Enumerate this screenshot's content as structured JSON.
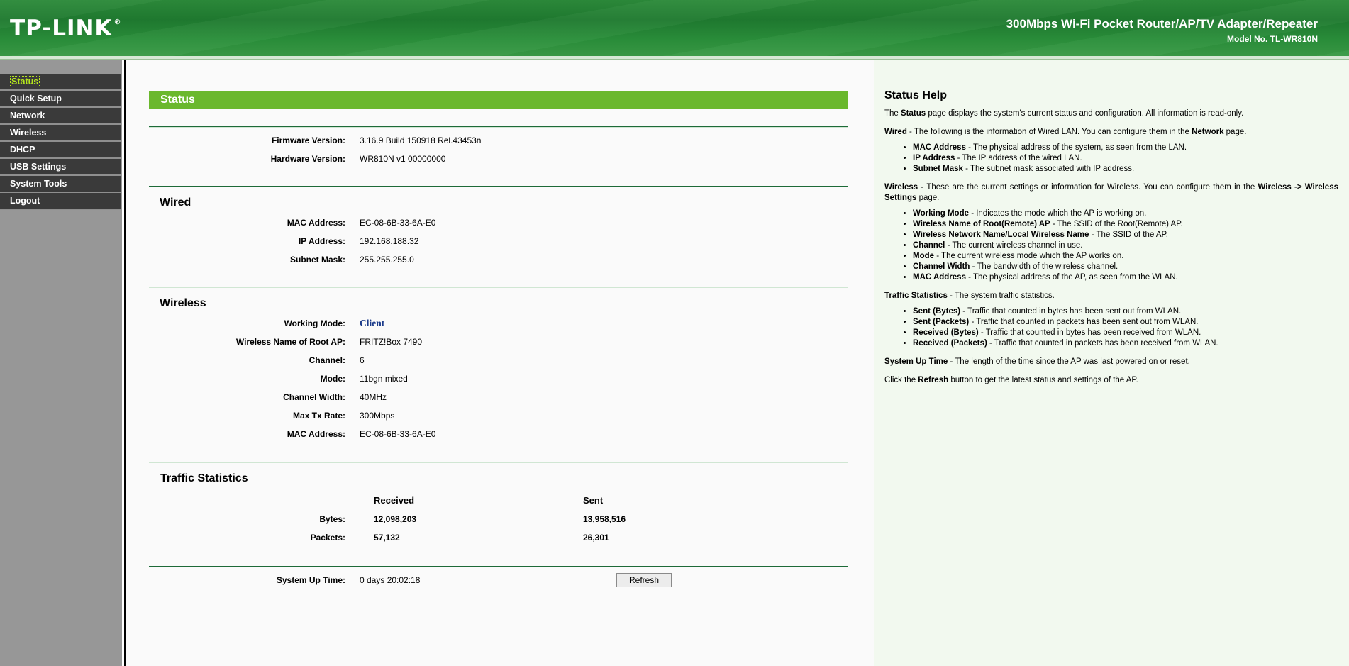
{
  "header": {
    "logo": "TP-LINK",
    "logo_reg": "®",
    "product": "300Mbps Wi-Fi Pocket Router/AP/TV Adapter/Repeater",
    "model": "Model No. TL-WR810N"
  },
  "sidebar": {
    "items": [
      {
        "label": "Status",
        "active": true
      },
      {
        "label": "Quick Setup"
      },
      {
        "label": "Network"
      },
      {
        "label": "Wireless"
      },
      {
        "label": "DHCP"
      },
      {
        "label": "USB Settings"
      },
      {
        "label": "System Tools"
      },
      {
        "label": "Logout"
      }
    ]
  },
  "main": {
    "title": "Status",
    "firmware": {
      "label": "Firmware Version:",
      "value": "3.16.9 Build 150918 Rel.43453n"
    },
    "hardware": {
      "label": "Hardware Version:",
      "value": "WR810N v1 00000000"
    },
    "wired": {
      "title": "Wired",
      "mac": {
        "label": "MAC Address:",
        "value": "EC-08-6B-33-6A-E0"
      },
      "ip": {
        "label": "IP Address:",
        "value": "192.168.188.32"
      },
      "subnet": {
        "label": "Subnet Mask:",
        "value": "255.255.255.0"
      }
    },
    "wireless": {
      "title": "Wireless",
      "working_mode": {
        "label": "Working Mode:",
        "value": "Client"
      },
      "root_ap": {
        "label": "Wireless Name of Root AP:",
        "value": "FRITZ!Box 7490"
      },
      "channel": {
        "label": "Channel:",
        "value": "6"
      },
      "mode": {
        "label": "Mode:",
        "value": "11bgn mixed"
      },
      "channel_width": {
        "label": "Channel Width:",
        "value": "40MHz"
      },
      "max_tx": {
        "label": "Max Tx Rate:",
        "value": "300Mbps"
      },
      "mac": {
        "label": "MAC Address:",
        "value": "EC-08-6B-33-6A-E0"
      }
    },
    "traffic": {
      "title": "Traffic Statistics",
      "col_received": "Received",
      "col_sent": "Sent",
      "bytes": {
        "label": "Bytes:",
        "received": "12,098,203",
        "sent": "13,958,516"
      },
      "packets": {
        "label": "Packets:",
        "received": "57,132",
        "sent": "26,301"
      }
    },
    "uptime": {
      "label": "System Up Time:",
      "value": "0 days 20:02:18"
    },
    "refresh_label": "Refresh"
  },
  "help": {
    "title": "Status Help",
    "intro": {
      "a": "The ",
      "b": "Status",
      "c": " page displays the system's current status and configuration. All information is read-only."
    },
    "wired": {
      "b": "Wired",
      "a": " - The following is the information of Wired LAN. You can configure them in the ",
      "b2": "Network",
      "c": " page."
    },
    "wired_items": [
      {
        "b": "MAC Address",
        "t": " - The physical address of the system, as seen from the LAN."
      },
      {
        "b": "IP Address",
        "t": " - The IP address of the wired LAN."
      },
      {
        "b": "Subnet Mask",
        "t": " - The subnet mask associated with IP address."
      }
    ],
    "wireless": {
      "b": "Wireless",
      "a": " - These are the current settings or information for Wireless. You can configure them in the ",
      "b2": "Wireless -> Wireless Settings",
      "c": " page."
    },
    "wireless_items": [
      {
        "b": "Working Mode",
        "t": " - Indicates the mode which the AP is working on."
      },
      {
        "b": "Wireless Name of Root(Remote) AP",
        "t": " - The SSID of the Root(Remote) AP."
      },
      {
        "b": "Wireless Network Name/Local Wireless Name",
        "t": " - The SSID of the AP."
      },
      {
        "b": "Channel",
        "t": " - The current wireless channel in use."
      },
      {
        "b": "Mode",
        "t": " - The current wireless mode which the AP works on."
      },
      {
        "b": "Channel Width",
        "t": " - The bandwidth of the wireless channel."
      },
      {
        "b": "MAC Address",
        "t": " - The physical address of the AP, as seen from the WLAN."
      }
    ],
    "traffic": {
      "b": "Traffic Statistics",
      "a": " - The system traffic statistics."
    },
    "traffic_items": [
      {
        "b": "Sent (Bytes)",
        "t": " - Traffic that counted in bytes has been sent out from WLAN."
      },
      {
        "b": "Sent (Packets)",
        "t": " - Traffic that counted in packets has been sent out from WLAN."
      },
      {
        "b": "Received (Bytes)",
        "t": " - Traffic that counted in bytes has been received from WLAN."
      },
      {
        "b": "Received (Packets)",
        "t": " - Traffic that counted in packets has been received from WLAN."
      }
    ],
    "uptime": {
      "b": "System Up Time",
      "a": " - The length of the time since the AP was last powered on or reset."
    },
    "refresh": {
      "a": "Click the ",
      "b": "Refresh",
      "c": " button to get the latest status and settings of the AP."
    }
  }
}
